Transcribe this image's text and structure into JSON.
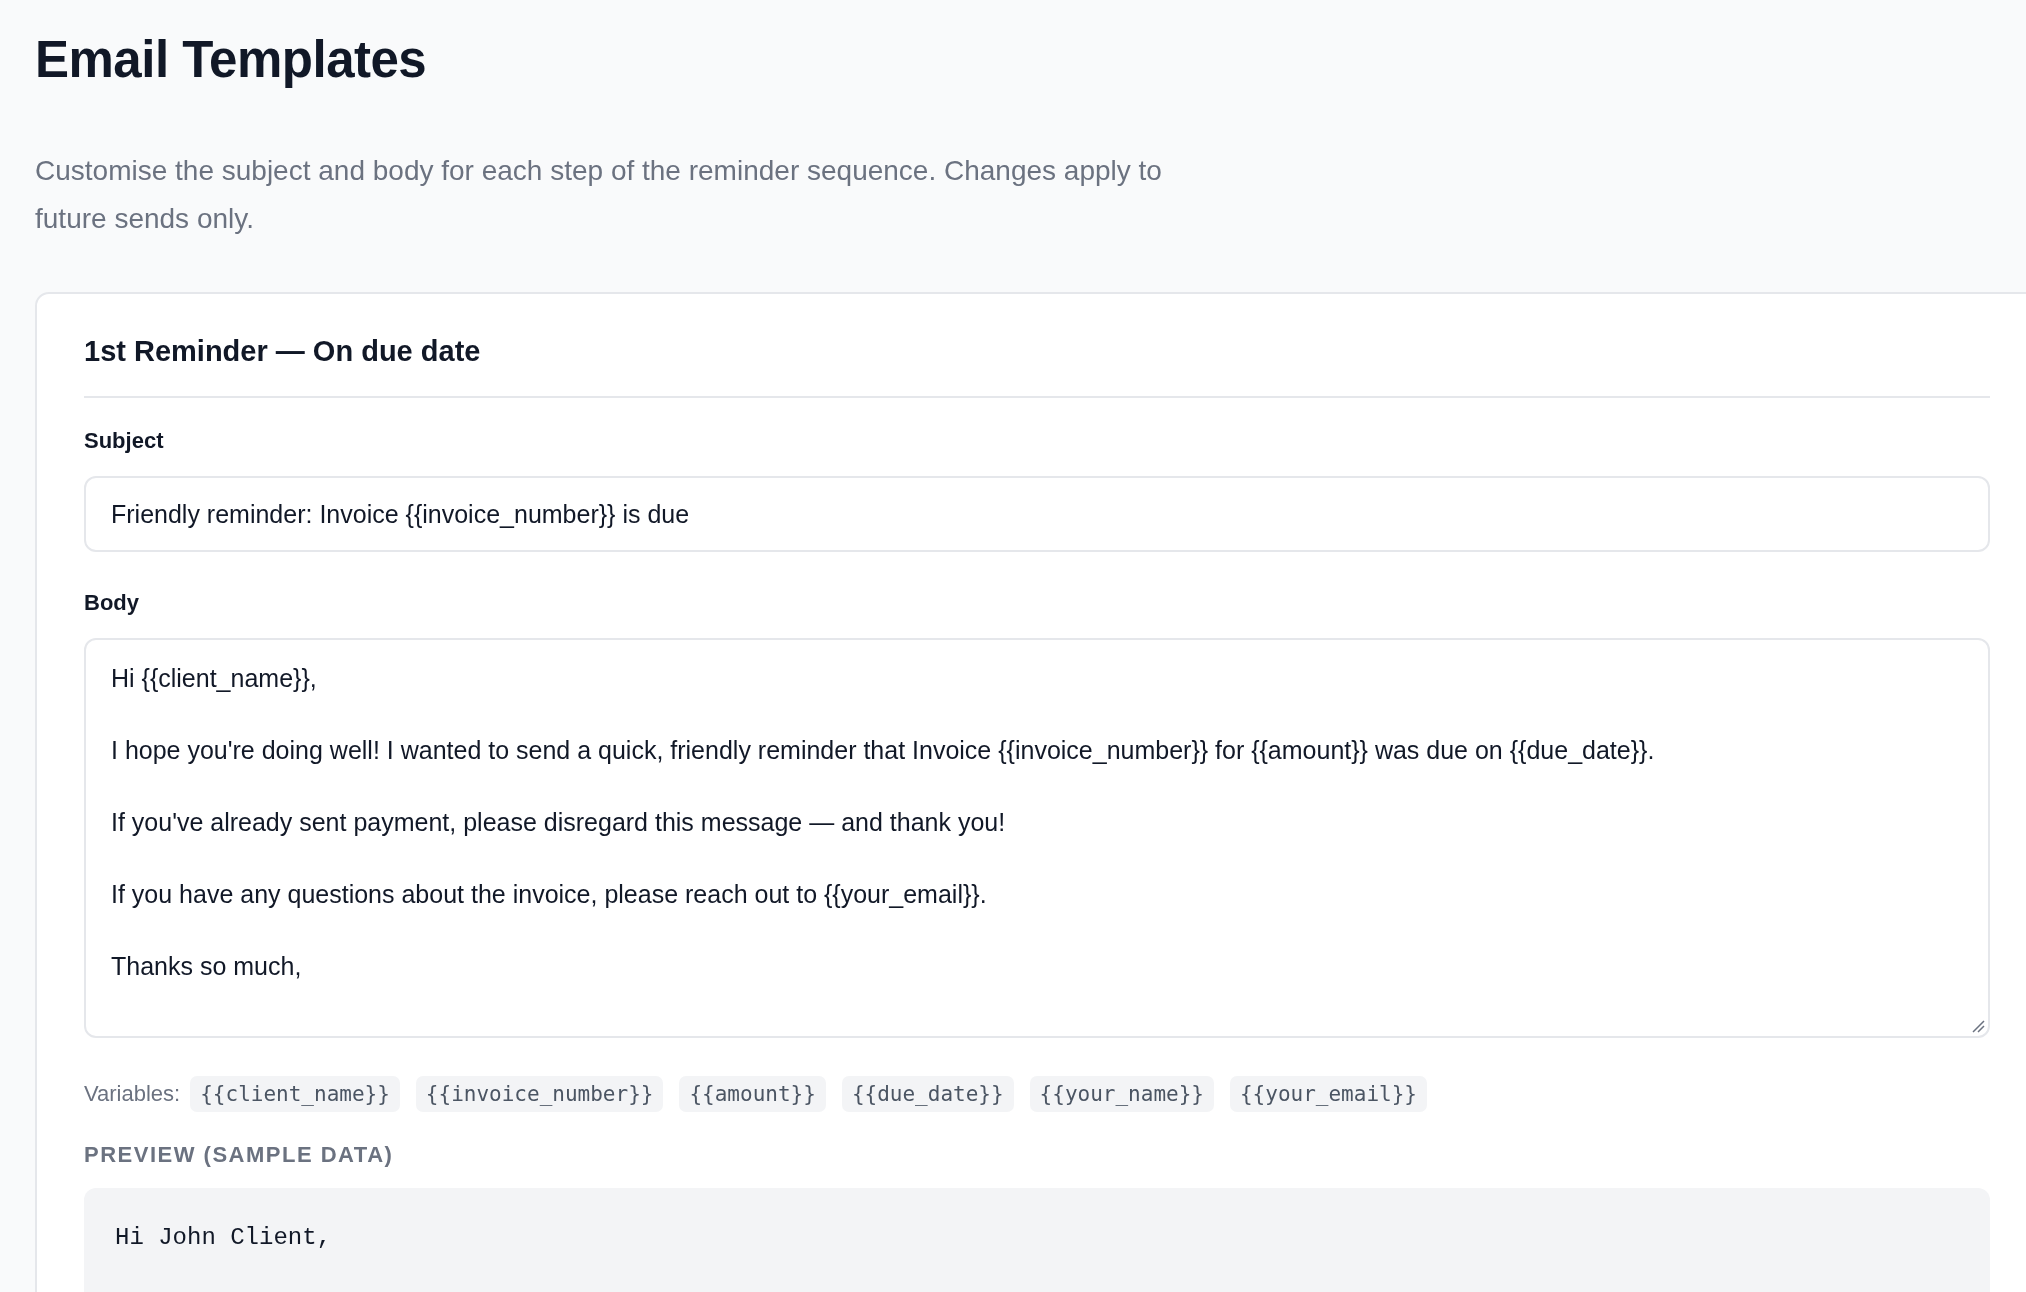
{
  "page": {
    "title": "Email Templates",
    "description": "Customise the subject and body for each step of the reminder sequence. Changes apply to future sends only."
  },
  "templates": [
    {
      "heading": "1st Reminder — On due date",
      "subject_label": "Subject",
      "subject": "Friendly reminder: Invoice {{invoice_number}} is due",
      "body_label": "Body",
      "body": "Hi {{client_name}},\n\nI hope you're doing well! I wanted to send a quick, friendly reminder that Invoice {{invoice_number}} for {{amount}} was due on {{due_date}}.\n\nIf you've already sent payment, please disregard this message — and thank you!\n\nIf you have any questions about the invoice, please reach out to {{your_email}}.\n\nThanks so much,",
      "variables_label": "Variables:",
      "variables": [
        "{{client_name}}",
        "{{invoice_number}}",
        "{{amount}}",
        "{{due_date}}",
        "{{your_name}}",
        "{{your_email}}"
      ],
      "preview_label": "PREVIEW (SAMPLE DATA)",
      "preview": "Hi John Client,"
    }
  ]
}
